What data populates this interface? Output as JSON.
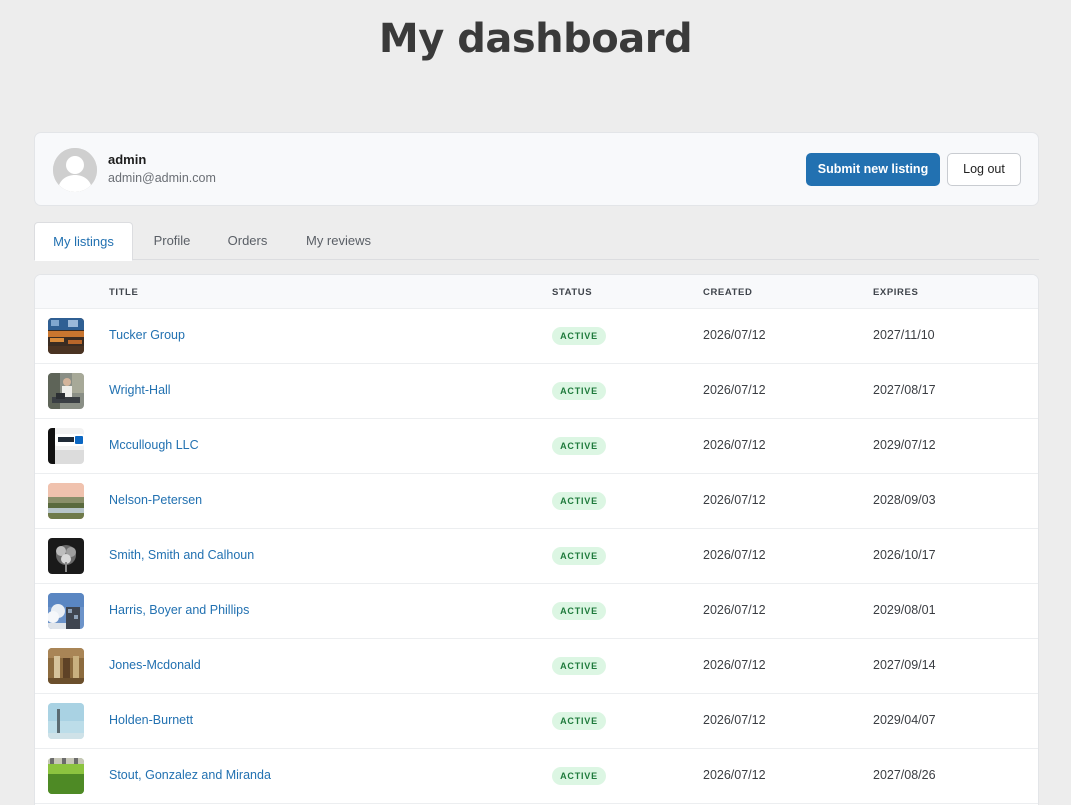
{
  "page_title": "My dashboard",
  "user": {
    "name": "admin",
    "email": "admin@admin.com"
  },
  "actions": {
    "submit_label": "Submit new listing",
    "logout_label": "Log out"
  },
  "tabs": [
    {
      "label": "My listings",
      "active": true
    },
    {
      "label": "Profile",
      "active": false
    },
    {
      "label": "Orders",
      "active": false
    },
    {
      "label": "My reviews",
      "active": false
    }
  ],
  "table": {
    "columns": {
      "title": "TITLE",
      "status": "STATUS",
      "created": "CREATED",
      "expires": "EXPIRES"
    },
    "rows": [
      {
        "title": "Tucker Group",
        "status": "ACTIVE",
        "created": "2026/07/12",
        "expires": "2027/11/10"
      },
      {
        "title": "Wright-Hall",
        "status": "ACTIVE",
        "created": "2026/07/12",
        "expires": "2027/08/17"
      },
      {
        "title": "Mccullough LLC",
        "status": "ACTIVE",
        "created": "2026/07/12",
        "expires": "2029/07/12"
      },
      {
        "title": "Nelson-Petersen",
        "status": "ACTIVE",
        "created": "2026/07/12",
        "expires": "2028/09/03"
      },
      {
        "title": "Smith, Smith and Calhoun",
        "status": "ACTIVE",
        "created": "2026/07/12",
        "expires": "2026/10/17"
      },
      {
        "title": "Harris, Boyer and Phillips",
        "status": "ACTIVE",
        "created": "2026/07/12",
        "expires": "2029/08/01"
      },
      {
        "title": "Jones-Mcdonald",
        "status": "ACTIVE",
        "created": "2026/07/12",
        "expires": "2027/09/14"
      },
      {
        "title": "Holden-Burnett",
        "status": "ACTIVE",
        "created": "2026/07/12",
        "expires": "2029/04/07"
      },
      {
        "title": "Stout, Gonzalez and Miranda",
        "status": "ACTIVE",
        "created": "2026/07/12",
        "expires": "2027/08/26"
      }
    ]
  },
  "colors": {
    "accent": "#2271b1",
    "badge_bg": "#dcf6e3",
    "badge_text": "#1e7a3b",
    "page_bg": "#ededed"
  },
  "icons": {
    "avatar": "user-silhouette-icon"
  }
}
